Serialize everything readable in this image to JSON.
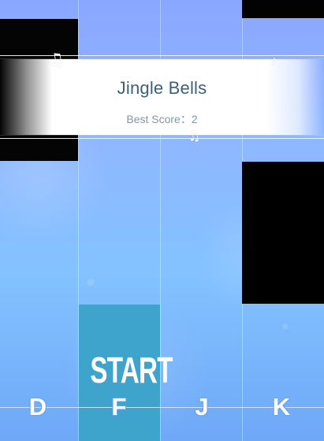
{
  "song": {
    "title": "Jingle Bells",
    "best_score_label": "Best Score：2"
  },
  "controls": {
    "start_label": "START",
    "keys": [
      "D",
      "F",
      "J",
      "K"
    ]
  },
  "decorations": {
    "note_1": "♫",
    "note_2": "♪",
    "note_3": "♫"
  },
  "colors": {
    "background_top": "#8aa7ff",
    "background_bottom": "#6ea8f7",
    "black_tile": "#000000",
    "start_tile": "#3ea4cc",
    "title_band": "#ffffff"
  }
}
